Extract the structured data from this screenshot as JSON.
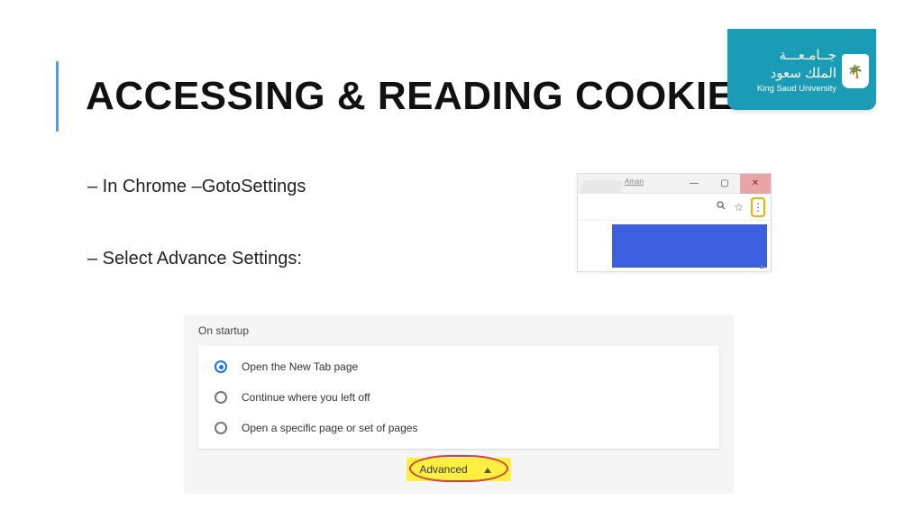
{
  "title": "ACCESSING & READING COOKIES",
  "bullets": {
    "b1": "– In Chrome –GotoSettings",
    "b2": "– Select Advance Settings:"
  },
  "logo": {
    "ar_line1": "جــامـعـــة",
    "ar_line2": "الملك سعود",
    "en": "King Saud University"
  },
  "chrome": {
    "tab_hint": "Aman",
    "minimize": "—",
    "maximize": "▢",
    "close": "✕",
    "search_icon": "search",
    "star_icon": "star",
    "menu_icon": "more"
  },
  "settings": {
    "section": "On startup",
    "options": [
      {
        "label": "Open the New Tab page",
        "selected": true
      },
      {
        "label": "Continue where you left off",
        "selected": false
      },
      {
        "label": "Open a specific page or set of pages",
        "selected": false
      }
    ],
    "advanced": "Advanced"
  }
}
